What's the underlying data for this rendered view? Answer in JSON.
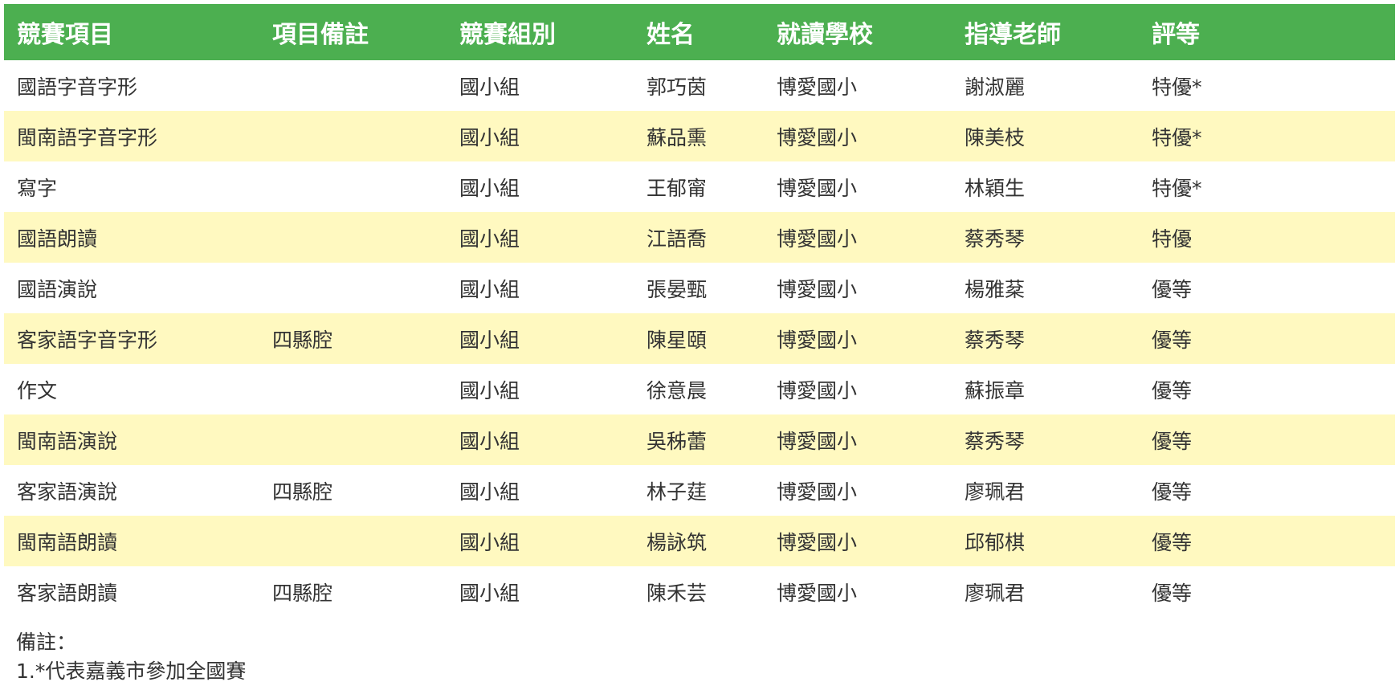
{
  "colors": {
    "header_bg": "#4caf50",
    "header_text": "#ffffff",
    "stripe_bg": "#fff9c0",
    "body_text": "#333333"
  },
  "table": {
    "headers": [
      "競賽項目",
      "項目備註",
      "競賽組別",
      "姓名",
      "就讀學校",
      "指導老師",
      "評等"
    ],
    "rows": [
      [
        "國語字音字形",
        "",
        "國小組",
        "郭巧茵",
        "博愛國小",
        "謝淑麗",
        "特優*"
      ],
      [
        "閩南語字音字形",
        "",
        "國小組",
        "蘇品熏",
        "博愛國小",
        "陳美枝",
        "特優*"
      ],
      [
        "寫字",
        "",
        "國小組",
        "王郁甯",
        "博愛國小",
        "林穎生",
        "特優*"
      ],
      [
        "國語朗讀",
        "",
        "國小組",
        "江語喬",
        "博愛國小",
        "蔡秀琴",
        "特優"
      ],
      [
        "國語演說",
        "",
        "國小組",
        "張晏甄",
        "博愛國小",
        "楊雅棻",
        "優等"
      ],
      [
        "客家語字音字形",
        "四縣腔",
        "國小組",
        "陳星頤",
        "博愛國小",
        "蔡秀琴",
        "優等"
      ],
      [
        "作文",
        "",
        "國小組",
        "徐意晨",
        "博愛國小",
        "蘇振章",
        "優等"
      ],
      [
        "閩南語演說",
        "",
        "國小組",
        "吳秭蕾",
        "博愛國小",
        "蔡秀琴",
        "優等"
      ],
      [
        "客家語演說",
        "四縣腔",
        "國小組",
        "林子莛",
        "博愛國小",
        "廖珮君",
        "優等"
      ],
      [
        "閩南語朗讀",
        "",
        "國小組",
        "楊詠筑",
        "博愛國小",
        "邱郁棋",
        "優等"
      ],
      [
        "客家語朗讀",
        "四縣腔",
        "國小組",
        "陳禾芸",
        "博愛國小",
        "廖珮君",
        "優等"
      ]
    ]
  },
  "notes": {
    "title": "備註：",
    "line1": "1.*代表嘉義市參加全國賽"
  }
}
